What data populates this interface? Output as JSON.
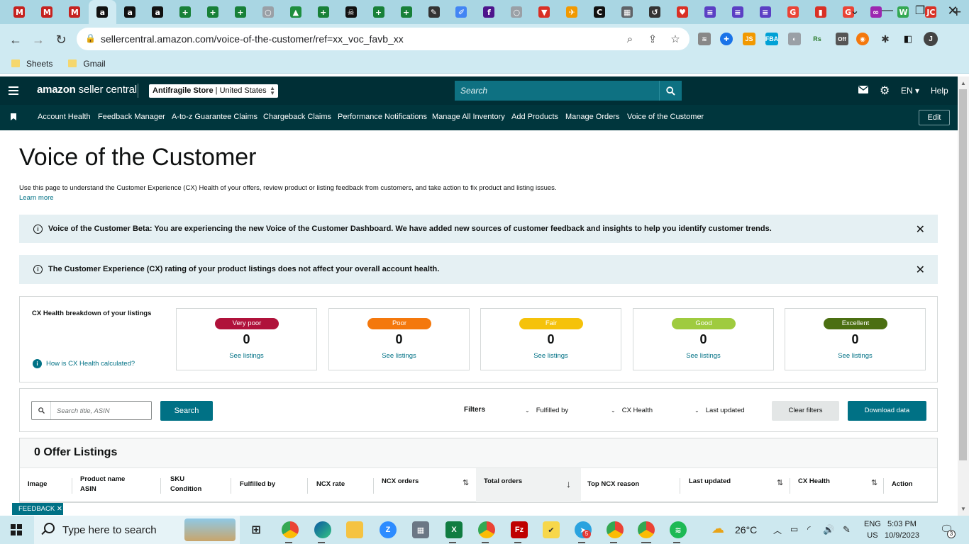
{
  "browser": {
    "url": "sellercentral.amazon.com/voice-of-the-customer/ref=xx_voc_favb_xx",
    "bookmarks": [
      "Sheets",
      "Gmail"
    ],
    "tab_favicons": [
      {
        "icon": "gmail-icon",
        "color": "#c5221f",
        "glyph": "M"
      },
      {
        "icon": "gmail-icon",
        "color": "#c5221f",
        "glyph": "M"
      },
      {
        "icon": "gmail-icon",
        "color": "#c5221f",
        "glyph": "M"
      },
      {
        "icon": "amazon-icon",
        "color": "#111111",
        "glyph": "a"
      },
      {
        "icon": "amazon-icon",
        "color": "#111111",
        "glyph": "a"
      },
      {
        "icon": "amazon-icon",
        "color": "#111111",
        "glyph": "a"
      },
      {
        "icon": "sheets-icon",
        "color": "#188038",
        "glyph": "+"
      },
      {
        "icon": "sheets-icon",
        "color": "#188038",
        "glyph": "+"
      },
      {
        "icon": "sheets-icon",
        "color": "#188038",
        "glyph": "+"
      },
      {
        "icon": "generic-icon",
        "color": "#9aa0a6",
        "glyph": "○"
      },
      {
        "icon": "drive-icon",
        "color": "#1e8e3e",
        "glyph": "▲"
      },
      {
        "icon": "sheets-icon",
        "color": "#188038",
        "glyph": "+"
      },
      {
        "icon": "pirate-icon",
        "color": "#111111",
        "glyph": "☠"
      },
      {
        "icon": "sheets-icon",
        "color": "#188038",
        "glyph": "+"
      },
      {
        "icon": "sheets-icon",
        "color": "#188038",
        "glyph": "+"
      },
      {
        "icon": "pen-icon",
        "color": "#333333",
        "glyph": "✎"
      },
      {
        "icon": "pencil-icon",
        "color": "#4285f4",
        "glyph": "✐"
      },
      {
        "icon": "fedex-icon",
        "color": "#4d148c",
        "glyph": "f"
      },
      {
        "icon": "generic-icon",
        "color": "#9aa0a6",
        "glyph": "○"
      },
      {
        "icon": "shield-icon",
        "color": "#d93025",
        "glyph": "▼"
      },
      {
        "icon": "feather-icon",
        "color": "#f29900",
        "glyph": "✈"
      },
      {
        "icon": "circle-c-icon",
        "color": "#111111",
        "glyph": "C"
      },
      {
        "icon": "image-icon",
        "color": "#5f6368",
        "glyph": "▦"
      },
      {
        "icon": "history-icon",
        "color": "#333333",
        "glyph": "↺"
      },
      {
        "icon": "heart-icon",
        "color": "#d93025",
        "glyph": "♥"
      },
      {
        "icon": "list-icon",
        "color": "#5b3fc4",
        "glyph": "≡"
      },
      {
        "icon": "list-icon",
        "color": "#5b3fc4",
        "glyph": "≡"
      },
      {
        "icon": "list-icon",
        "color": "#5b3fc4",
        "glyph": "≡"
      },
      {
        "icon": "google-icon",
        "color": "#ea4335",
        "glyph": "G"
      },
      {
        "icon": "red-icon",
        "color": "#d93025",
        "glyph": "▮"
      },
      {
        "icon": "google-icon",
        "color": "#ea4335",
        "glyph": "G"
      },
      {
        "icon": "glasses-icon",
        "color": "#9c27b0",
        "glyph": "∞"
      },
      {
        "icon": "w-icon",
        "color": "#34a853",
        "glyph": "W"
      },
      {
        "icon": "jc-icon",
        "color": "#d93025",
        "glyph": "JC"
      }
    ]
  },
  "header": {
    "logo_bold": "amazon",
    "logo_rest": " seller central",
    "store_name": "Antifragile Store",
    "store_region": "United States",
    "search_placeholder": "Search",
    "language": "EN",
    "help": "Help"
  },
  "nav": {
    "items": [
      "Account Health",
      "Feedback Manager",
      "A-to-z Guarantee Claims",
      "Chargeback Claims",
      "Performance Notifications",
      "Manage All Inventory",
      "Add Products",
      "Manage Orders",
      "Voice of the Customer"
    ],
    "edit": "Edit"
  },
  "page": {
    "title": "Voice of the Customer",
    "description": "Use this page to understand the Customer Experience (CX) Health of your offers, review product or listing feedback from customers, and take action to fix product and listing issues.",
    "learn_more": "Learn more"
  },
  "banners": [
    "Voice of the Customer Beta: You are experiencing the new Voice of the Customer Dashboard. We have added new sources of customer feedback and insights to help you identify customer trends.",
    "The Customer Experience (CX) rating of your product listings does not affect your overall account health."
  ],
  "cx": {
    "title": "CX Health breakdown of your listings",
    "how_link": "How is CX Health calculated?",
    "cards": [
      {
        "label": "Very poor",
        "count": "0",
        "link": "See listings",
        "color": "#b0123b"
      },
      {
        "label": "Poor",
        "count": "0",
        "link": "See listings",
        "color": "#f4780d"
      },
      {
        "label": "Fair",
        "count": "0",
        "link": "See listings",
        "color": "#f5c20a"
      },
      {
        "label": "Good",
        "count": "0",
        "link": "See listings",
        "color": "#9fcb3f"
      },
      {
        "label": "Excellent",
        "count": "0",
        "link": "See listings",
        "color": "#4b6f12"
      }
    ]
  },
  "filters": {
    "search_placeholder": "Search title, ASIN",
    "search_button": "Search",
    "label": "Filters",
    "dropdowns": [
      "Fulfilled by",
      "CX Health",
      "Last updated"
    ],
    "clear": "Clear filters",
    "download": "Download data"
  },
  "listings": {
    "title": "0 Offer Listings",
    "columns": {
      "image": "Image",
      "product_name": "Product name",
      "asin": "ASIN",
      "sku": "SKU",
      "condition": "Condition",
      "fulfilled_by": "Fulfilled by",
      "ncx_rate": "NCX rate",
      "ncx_orders": "NCX orders",
      "total_orders": "Total orders",
      "top_ncx_reason": "Top NCX reason",
      "last_updated": "Last updated",
      "cx_health": "CX Health",
      "action": "Action"
    }
  },
  "feedback_tab": "FEEDBACK",
  "taskbar": {
    "search_placeholder": "Type here to search",
    "weather": "26°C",
    "lang_top": "ENG",
    "lang_bottom": "US",
    "time": "5:03 PM",
    "date": "10/9/2023",
    "notifications": "3",
    "telegram_badge": "5"
  }
}
